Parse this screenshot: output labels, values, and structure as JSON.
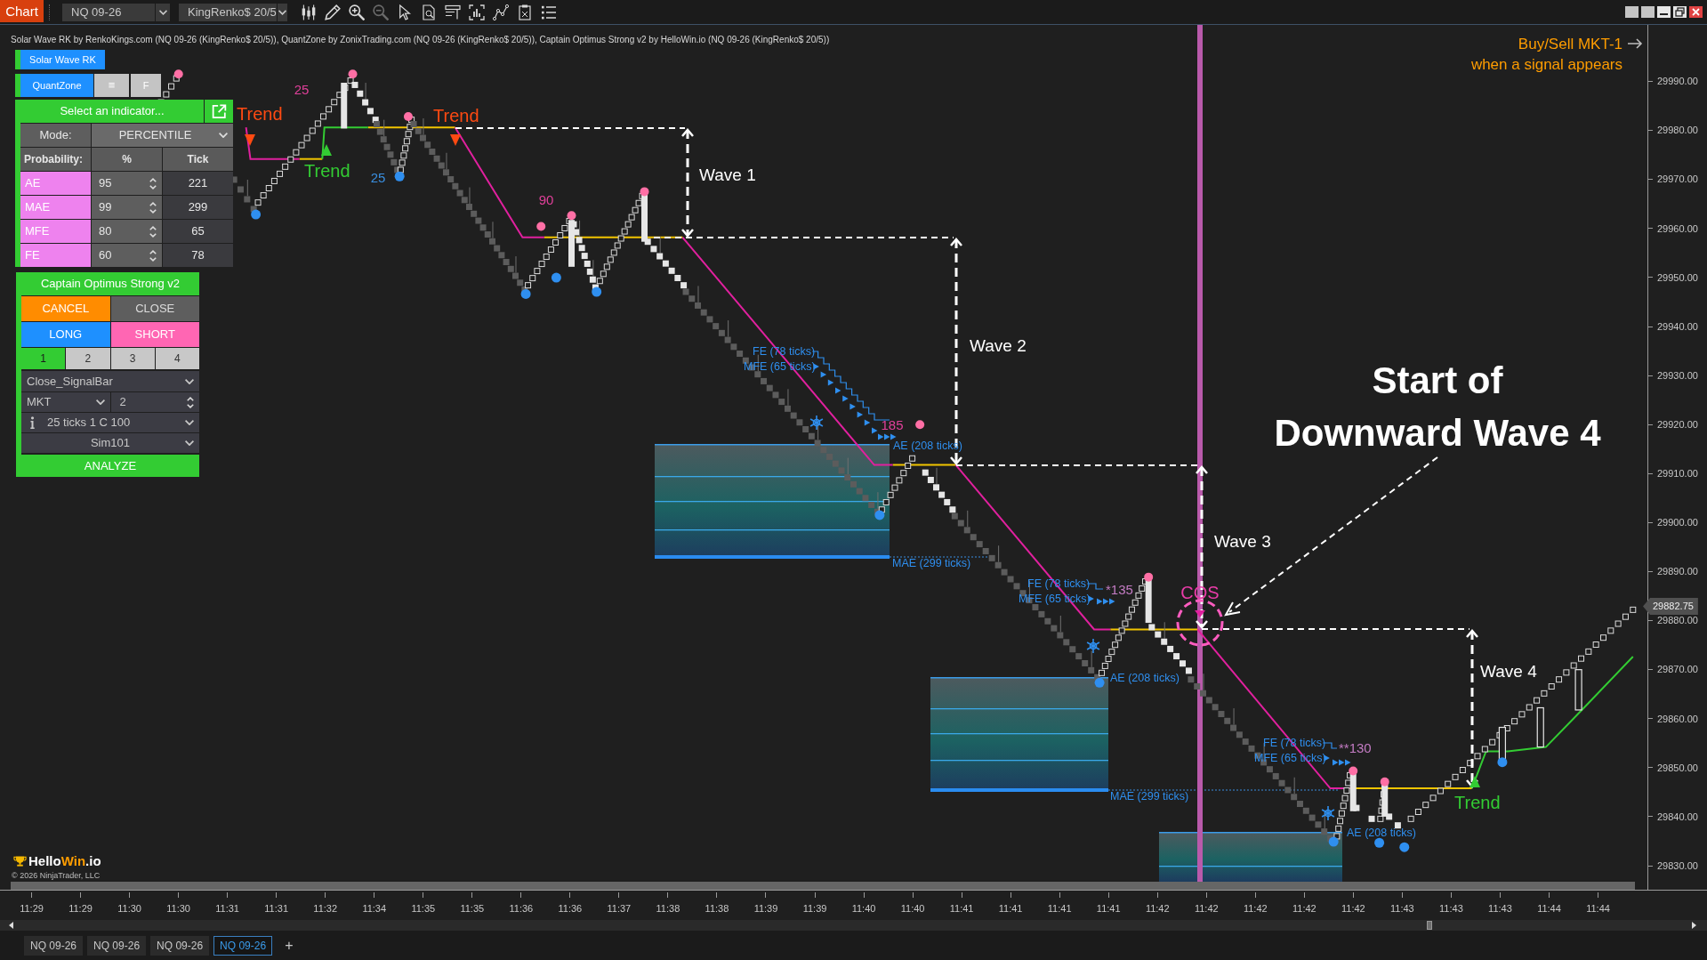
{
  "toolbar": {
    "app_button": "Chart",
    "instrument": "NQ 09-26",
    "bar_type": "KingRenko$ 20/5"
  },
  "indicator_legend": "Solar Wave RK by RenkoKings.com (NQ 09-26 (KingRenko$ 20/5)), QuantZone by ZonixTrading.com (NQ 09-26 (KingRenko$ 20/5)), Captain Optimus Strong v2 by HelloWin.io (NQ 09-26 (KingRenko$ 20/5))",
  "indicator_panel": {
    "solar_wave_button": "Solar Wave RK",
    "quantzone_button": "QuantZone",
    "menu_button": "≡",
    "f_button": "F",
    "indicator_select": "Select an indicator...",
    "mode": {
      "label": "Mode:",
      "value": "PERCENTILE"
    },
    "columns": [
      "Probability:",
      "%",
      "Tick"
    ],
    "probabilities": [
      {
        "name": "AE",
        "percent": "95",
        "tick": "221"
      },
      {
        "name": "MAE",
        "percent": "99",
        "tick": "299"
      },
      {
        "name": "MFE",
        "percent": "80",
        "tick": "65"
      },
      {
        "name": "FE",
        "percent": "60",
        "tick": "78"
      }
    ]
  },
  "strategy_panel": {
    "title": "Captain Optimus Strong v2",
    "buttons": [
      {
        "label": "CANCEL",
        "kind": "cancel"
      },
      {
        "label": "CLOSE",
        "kind": "close"
      },
      {
        "label": "LONG",
        "kind": "long"
      },
      {
        "label": "SHORT",
        "kind": "short"
      }
    ],
    "quantity_tabs": [
      {
        "label": "1",
        "selected": true
      },
      {
        "label": "2",
        "selected": false
      },
      {
        "label": "3",
        "selected": false
      },
      {
        "label": "4",
        "selected": false
      }
    ],
    "exit_mode": "Close_SignalBar",
    "order_type": "MKT",
    "quantity": "2",
    "order_info": "25 ticks 1 C 100",
    "account": "Sim101",
    "analyze_button": "ANALYZE"
  },
  "chart": {
    "signal_note": "Buy/Sell MKT-1\nwhen a signal appears",
    "trend_labels": [
      {
        "text": "Trend",
        "kind": "down"
      },
      {
        "text": "Trend",
        "kind": "up"
      },
      {
        "text": "Trend",
        "kind": "down"
      },
      {
        "text": "Trend",
        "kind": "up"
      }
    ],
    "bar_counts": [
      {
        "text": "25",
        "kind": "high"
      },
      {
        "text": "25",
        "kind": "low"
      },
      {
        "text": "90",
        "kind": "high"
      },
      {
        "text": "185",
        "kind": "high"
      },
      {
        "text": "*135",
        "kind": "target"
      },
      {
        "text": "**130",
        "kind": "target"
      }
    ],
    "wave_labels": [
      "Wave 1",
      "Wave 2",
      "Wave 3",
      "Wave 4"
    ],
    "headline": "Start of\nDownward Wave 4",
    "cos_label": "COS",
    "excursion_labels": [
      {
        "text": "FE (78 ticks)",
        "kind": "fe"
      },
      {
        "text": "MFE (65 ticks)",
        "kind": "mfe"
      },
      {
        "text": "AE (208 ticks)",
        "kind": "ae"
      },
      {
        "text": "MAE (299 ticks)",
        "kind": "mae"
      },
      {
        "text": "FE (78 ticks)",
        "kind": "fe"
      },
      {
        "text": "MFE (65 ticks)",
        "kind": "mfe"
      },
      {
        "text": "AE (208 ticks)",
        "kind": "ae"
      },
      {
        "text": "MAE (299 ticks)",
        "kind": "mae"
      },
      {
        "text": "FE (78 ticks)",
        "kind": "fe"
      },
      {
        "text": "MFE (65 ticks)",
        "kind": "mfe"
      },
      {
        "text": "AE (208 ticks)",
        "kind": "ae"
      }
    ],
    "price_axis": {
      "labels": [
        "29990.00",
        "29980.00",
        "29970.00",
        "29960.00",
        "29950.00",
        "29940.00",
        "29930.00",
        "29920.00",
        "29910.00",
        "29900.00",
        "29890.00",
        "29880.00",
        "29870.00",
        "29860.00",
        "29850.00",
        "29840.00",
        "29830.00"
      ],
      "current_price": "29882.75"
    },
    "time_axis": [
      "11:29",
      "11:29",
      "11:30",
      "11:30",
      "11:31",
      "11:31",
      "11:32",
      "11:34",
      "11:35",
      "11:35",
      "11:36",
      "11:36",
      "11:37",
      "11:38",
      "11:38",
      "11:39",
      "11:39",
      "11:40",
      "11:40",
      "11:41",
      "11:41",
      "11:41",
      "11:41",
      "11:42",
      "11:42",
      "11:42",
      "11:42",
      "11:42",
      "11:43",
      "11:43",
      "11:43",
      "11:44",
      "11:44"
    ]
  },
  "logo": {
    "parts": [
      {
        "text": "Hello",
        "highlight": false
      },
      {
        "text": "Win",
        "highlight": true
      },
      {
        "text": ".io",
        "highlight": false
      }
    ],
    "copyright": "© 2026 NinjaTrader, LLC"
  },
  "tabs": [
    {
      "label": "NQ 09-26",
      "selected": false
    },
    {
      "label": "NQ 09-26",
      "selected": false
    },
    {
      "label": "NQ 09-26",
      "selected": false
    },
    {
      "label": "NQ 09-26",
      "selected": true
    }
  ],
  "add_tab": "+"
}
